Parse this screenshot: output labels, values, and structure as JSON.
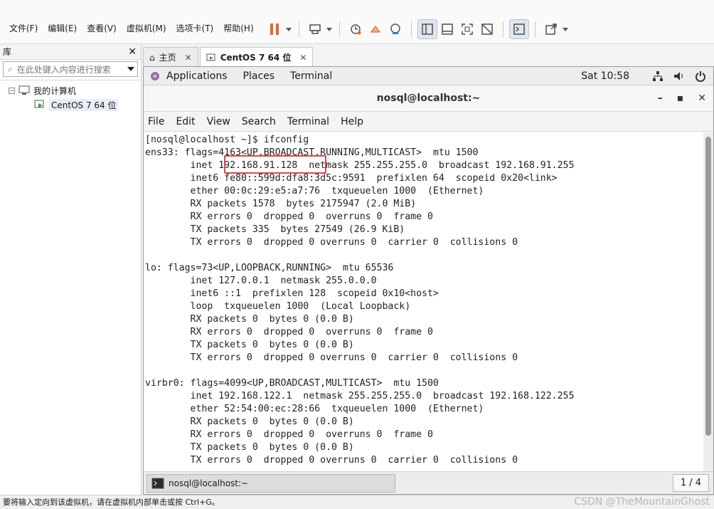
{
  "vmware": {
    "menu": [
      "文件(F)",
      "编辑(E)",
      "查看(V)",
      "虚拟机(M)",
      "选项卡(T)",
      "帮助(H)"
    ],
    "toolbar_icons": [
      "pause-icon",
      "send-keys-icon",
      "snapshot-icon",
      "revert-snapshot-icon",
      "manage-snapshots-icon",
      "library-view-icon",
      "single-window-icon",
      "fullscreen-icon",
      "unity-icon",
      "console-icon",
      "stretch-icon"
    ],
    "accent": "#e8662c"
  },
  "library": {
    "title": "库",
    "search_placeholder": "在此处键入内容进行搜索",
    "root": "我的计算机",
    "vm_item": "CentOS 7 64 位"
  },
  "tabs": [
    {
      "label": "主页",
      "current": false
    },
    {
      "label": "CentOS 7 64 位",
      "current": true
    }
  ],
  "gnome": {
    "menus": [
      "Applications",
      "Places",
      "Terminal"
    ],
    "clock": "Sat 10:58"
  },
  "window": {
    "title": "nosql@localhost:~"
  },
  "terminal_menu": [
    "File",
    "Edit",
    "View",
    "Search",
    "Terminal",
    "Help"
  ],
  "terminal": {
    "highlight_color": "#e0474c",
    "lines": [
      "[nosql@localhost ~]$ ifconfig",
      "ens33: flags=4163<UP,BROADCAST,RUNNING,MULTICAST>  mtu 1500",
      "        inet 192.168.91.128  netmask 255.255.255.0  broadcast 192.168.91.255",
      "        inet6 fe80::599d:dfa8:3d5c:9591  prefixlen 64  scopeid 0x20<link>",
      "        ether 00:0c:29:e5:a7:76  txqueuelen 1000  (Ethernet)",
      "        RX packets 1578  bytes 2175947 (2.0 MiB)",
      "        RX errors 0  dropped 0  overruns 0  frame 0",
      "        TX packets 335  bytes 27549 (26.9 KiB)",
      "        TX errors 0  dropped 0 overruns 0  carrier 0  collisions 0",
      "",
      "lo: flags=73<UP,LOOPBACK,RUNNING>  mtu 65536",
      "        inet 127.0.0.1  netmask 255.0.0.0",
      "        inet6 ::1  prefixlen 128  scopeid 0x10<host>",
      "        loop  txqueuelen 1000  (Local Loopback)",
      "        RX packets 0  bytes 0 (0.0 B)",
      "        RX errors 0  dropped 0  overruns 0  frame 0",
      "        TX packets 0  bytes 0 (0.0 B)",
      "        TX errors 0  dropped 0 overruns 0  carrier 0  collisions 0",
      "",
      "virbr0: flags=4099<UP,BROADCAST,MULTICAST>  mtu 1500",
      "        inet 192.168.122.1  netmask 255.255.255.0  broadcast 192.168.122.255",
      "        ether 52:54:00:ec:28:66  txqueuelen 1000  (Ethernet)",
      "        RX packets 0  bytes 0 (0.0 B)",
      "        RX errors 0  dropped 0  overruns 0  frame 0",
      "        TX packets 0  bytes 0 (0.0 B)",
      "        TX errors 0  dropped 0 overruns 0  carrier 0  collisions 0"
    ]
  },
  "taskbar": {
    "item": "nosql@localhost:~",
    "pager": "1 / 4"
  },
  "statusbar": {
    "text": "要将输入定向到该虚拟机，请在虚拟机内部单击或按 Ctrl+G。",
    "watermark": "CSDN @TheMountainGhost"
  }
}
